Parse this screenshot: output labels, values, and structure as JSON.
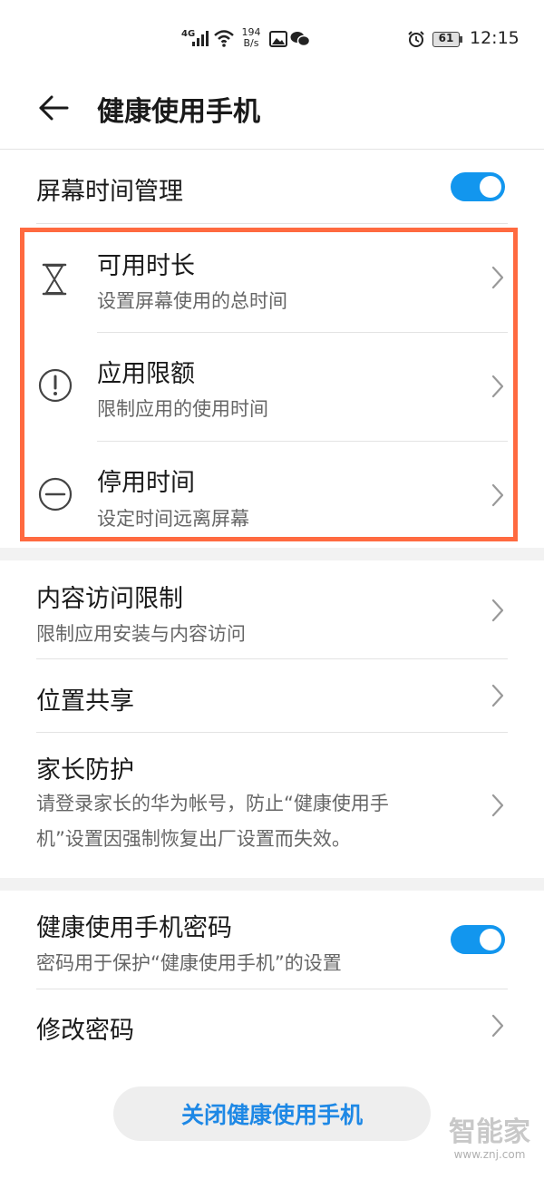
{
  "status_bar": {
    "network": "4G",
    "speed_value": "194",
    "speed_unit": "B/s",
    "battery": "61",
    "time": "12:15"
  },
  "header": {
    "title": "健康使用手机"
  },
  "screen_time": {
    "label": "屏幕时间管理",
    "enabled": true
  },
  "highlighted_items": [
    {
      "title": "可用时长",
      "subtitle": "设置屏幕使用的总时间",
      "icon": "hourglass-icon"
    },
    {
      "title": "应用限额",
      "subtitle": "限制应用的使用时间",
      "icon": "exclamation-circle-icon"
    },
    {
      "title": "停用时间",
      "subtitle": "设定时间远离屏幕",
      "icon": "minus-circle-icon"
    }
  ],
  "content_restrictions": {
    "title": "内容访问限制",
    "subtitle": "限制应用安装与内容访问"
  },
  "location_sharing": {
    "title": "位置共享"
  },
  "parental_protection": {
    "title": "家长防护",
    "line1": "请登录家长的华为帐号，防止“健康使用手",
    "line2": "机”设置因强制恢复出厂设置而失效。"
  },
  "password": {
    "title": "健康使用手机密码",
    "subtitle": "密码用于保护“健康使用手机”的设置",
    "enabled": true
  },
  "change_password": {
    "title": "修改密码"
  },
  "close_button": {
    "label": "关闭健康使用手机"
  },
  "watermark": {
    "logo": "智能家",
    "url": "www.znj.com"
  },
  "colors": {
    "accent": "#1e88e5",
    "toggle_on": "#1296ee",
    "highlight": "#ff6a40",
    "section_gap": "#f2f2f2"
  }
}
